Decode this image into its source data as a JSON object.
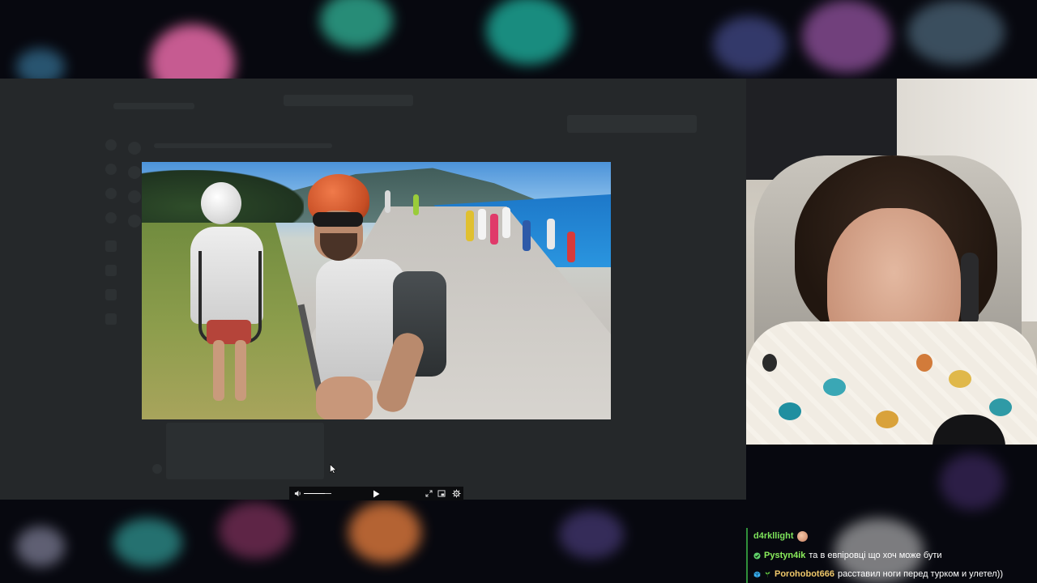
{
  "player": {
    "volume_level": 0.75
  },
  "chat": {
    "messages": [
      {
        "user": "d4rkllight",
        "user_color": "#7de35b",
        "text": "",
        "emote": "face-emote"
      },
      {
        "user": "Pystyn4ik",
        "user_color": "#8bee5c",
        "text": "та в евпіровці що хоч може бути",
        "badge": "check-badge"
      },
      {
        "user": "Porohobot666",
        "user_color": "#f0c86a",
        "text": "расставил ноги перед турком и улетел))",
        "badge": "cube-badge"
      }
    ]
  },
  "colors": {
    "panel": "#25282a",
    "control_bar": "#0b0c0e",
    "chat_border": "#2f8f3a"
  }
}
